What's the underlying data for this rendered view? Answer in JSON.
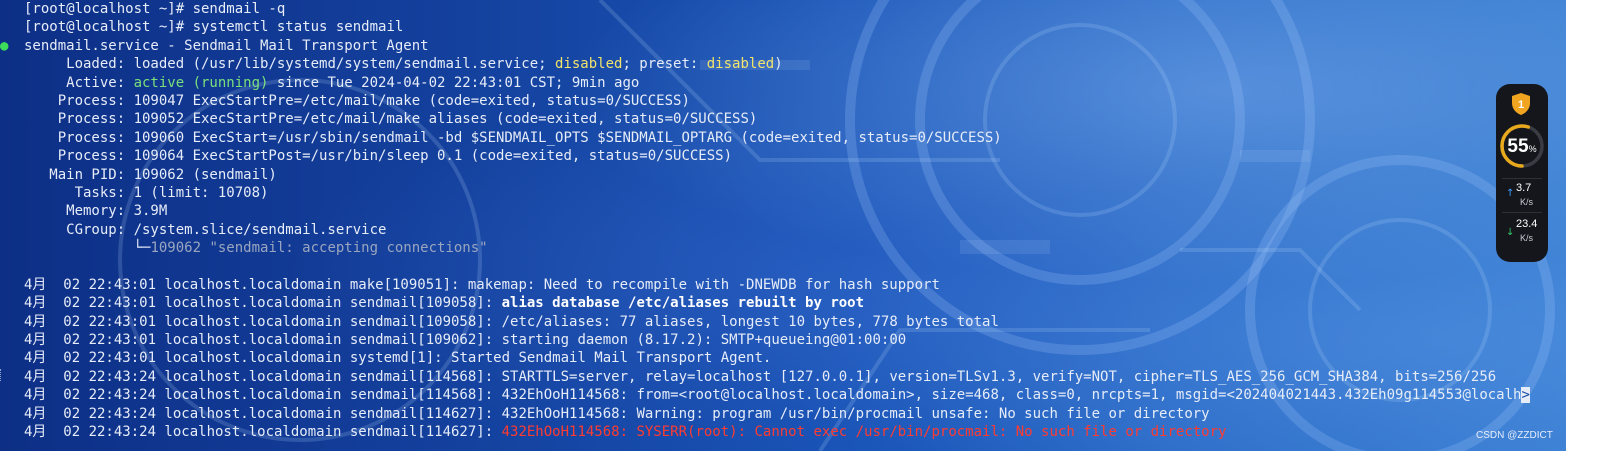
{
  "terminal": {
    "prompt_lines": [
      {
        "prompt": "[root@localhost ~]# ",
        "command": "sendmail -q"
      },
      {
        "prompt": "[root@localhost ~]# ",
        "command": "systemctl status sendmail"
      }
    ],
    "status": {
      "dot": "●",
      "title": "sendmail.service - Sendmail Mail Transport Agent",
      "loaded": {
        "label": "     Loaded: ",
        "pre": "loaded (/usr/lib/systemd/system/sendmail.service; ",
        "state": "disabled",
        "mid": "; preset: ",
        "preset": "disabled",
        "post": ")"
      },
      "active": {
        "label": "     Active: ",
        "state": "active (running)",
        "post": " since Tue 2024-04-02 22:43:01 CST; 9min ago"
      },
      "processes": [
        "    Process: 109047 ExecStartPre=/etc/mail/make (code=exited, status=0/SUCCESS)",
        "    Process: 109052 ExecStartPre=/etc/mail/make aliases (code=exited, status=0/SUCCESS)",
        "    Process: 109060 ExecStart=/usr/sbin/sendmail -bd $SENDMAIL_OPTS $SENDMAIL_OPTARG (code=exited, status=0/SUCCESS)",
        "    Process: 109064 ExecStartPost=/usr/bin/sleep 0.1 (code=exited, status=0/SUCCESS)"
      ],
      "main_pid": "   Main PID: 109062 (sendmail)",
      "tasks": "      Tasks: 1 (limit: 10708)",
      "memory": "     Memory: 3.9M",
      "cgroup": "     CGroup: /system.slice/sendmail.service",
      "cgroup_tree_prefix": "             └─",
      "cgroup_tree_item": "109062 \"sendmail: accepting connections\""
    },
    "logs": [
      {
        "prefix": "4月  02 22:43:01 localhost.localdomain make[109051]: ",
        "msg": "makemap: Need to recompile with -DNEWDB for hash support",
        "style": "normal"
      },
      {
        "prefix": "4月  02 22:43:01 localhost.localdomain sendmail[109058]: ",
        "msg": "alias database /etc/aliases rebuilt by root",
        "style": "bold"
      },
      {
        "prefix": "4月  02 22:43:01 localhost.localdomain sendmail[109058]: ",
        "msg": "/etc/aliases: 77 aliases, longest 10 bytes, 778 bytes total",
        "style": "normal"
      },
      {
        "prefix": "4月  02 22:43:01 localhost.localdomain sendmail[109062]: ",
        "msg": "starting daemon (8.17.2): SMTP+queueing@01:00:00",
        "style": "normal"
      },
      {
        "prefix": "4月  02 22:43:01 localhost.localdomain systemd[1]: ",
        "msg": "Started Sendmail Mail Transport Agent.",
        "style": "normal"
      },
      {
        "prefix": "4月  02 22:43:24 localhost.localdomain sendmail[114568]: ",
        "msg": "STARTTLS=server, relay=localhost [127.0.0.1], version=TLSv1.3, verify=NOT, cipher=TLS_AES_256_GCM_SHA384, bits=256/256",
        "style": "normal"
      },
      {
        "prefix": "4月  02 22:43:24 localhost.localdomain sendmail[114568]: ",
        "msg": "432EhOoH114568: from=<root@localhost.localdomain>, size=468, class=0, nrcpts=1, msgid=<202404021443.432Eh09g114553@localh",
        "style": "normal",
        "cursor": ">"
      },
      {
        "prefix": "4月  02 22:43:24 localhost.localdomain sendmail[114627]: ",
        "msg": "432EhOoH114568: Warning: program /usr/bin/procmail unsafe: No such file or directory",
        "style": "normal"
      },
      {
        "prefix": "4月  02 22:43:24 localhost.localdomain sendmail[114627]: ",
        "msg": "432EhOoH114568: SYSERR(root): Cannot exec /usr/bin/procmail: No such file or directory",
        "style": "red"
      }
    ]
  },
  "widget": {
    "cpu_percent": 55,
    "cpu_value": "55",
    "cpu_unit": "%",
    "upload": {
      "value": "3.7",
      "unit": "K/s"
    },
    "download": {
      "value": "23.4",
      "unit": "K/s"
    },
    "shield_icon": "shield-icon",
    "colors": {
      "ring": "#e8a91c",
      "ring_track": "#3a3c44",
      "up_arrow": "#3aa0ff",
      "down_arrow": "#32c96b",
      "shield": "#f0a420"
    }
  },
  "watermark": "CSDN @ZZDICT"
}
